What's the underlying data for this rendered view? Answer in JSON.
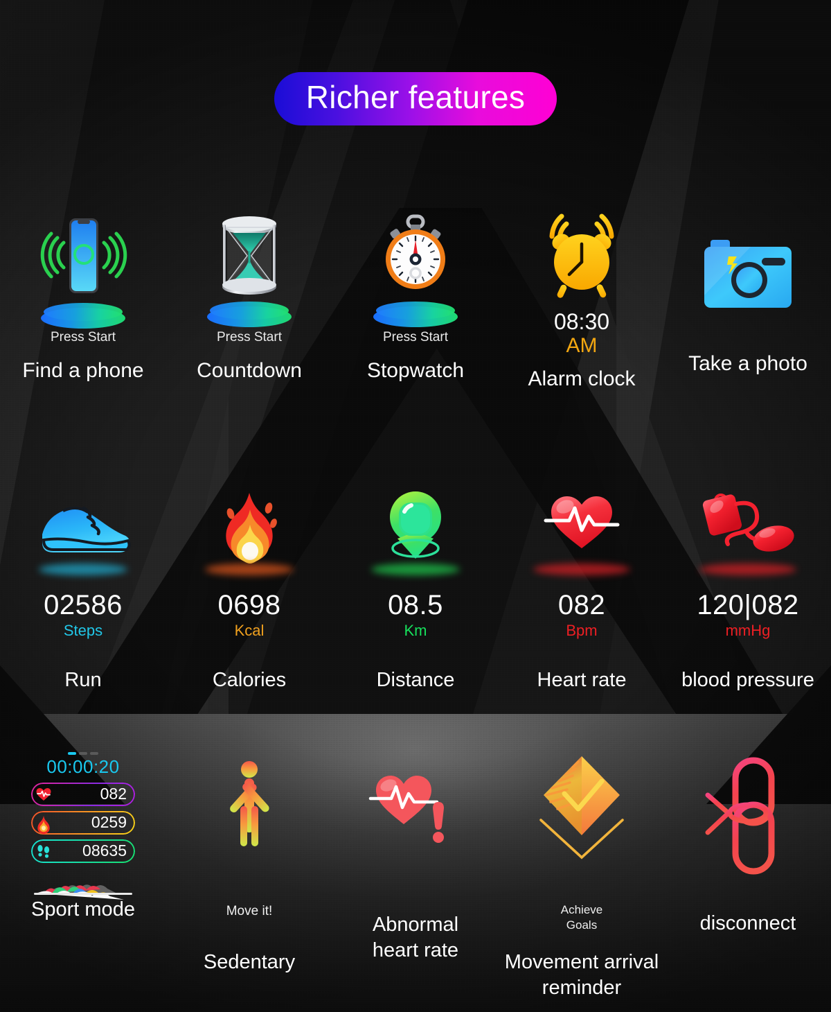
{
  "header": {
    "title": "Richer features",
    "gradient_from": "#1a0dd6",
    "gradient_to": "#ff00d4"
  },
  "row1": {
    "items": [
      {
        "label": "Find a phone",
        "status": "Press Start",
        "icon": "phone-ringing-icon",
        "has_pedestal": true
      },
      {
        "label": "Countdown",
        "status": "Press Start",
        "icon": "hourglass-icon",
        "has_pedestal": true
      },
      {
        "label": "Stopwatch",
        "status": "Press Start",
        "icon": "stopwatch-icon",
        "has_pedestal": true
      },
      {
        "label": "Alarm clock",
        "time": "08:30",
        "ampm": "AM",
        "icon": "alarm-clock-icon",
        "has_pedestal": false
      },
      {
        "label": "Take a photo",
        "icon": "camera-icon",
        "has_pedestal": false
      }
    ]
  },
  "row2": {
    "items": [
      {
        "label": "Run",
        "value": "02586",
        "unit": "Steps",
        "unit_color": "#21c7e8",
        "icon": "running-shoe-icon",
        "glow_color": "#1fa6c8"
      },
      {
        "label": "Calories",
        "value": "0698",
        "unit": "Kcal",
        "unit_color": "#f0a01e",
        "icon": "flame-icon",
        "glow_color": "#d8541c"
      },
      {
        "label": "Distance",
        "value": "08.5",
        "unit": "Km",
        "unit_color": "#17e05c",
        "icon": "location-pin-icon",
        "glow_color": "#1ec24a"
      },
      {
        "label": "Heart rate",
        "value": "082",
        "unit": "Bpm",
        "unit_color": "#ee1f24",
        "icon": "heart-pulse-icon",
        "glow_color": "#cf1f24"
      },
      {
        "label": "blood pressure",
        "value": "120|082",
        "unit": "mmHg",
        "unit_color": "#ee1f24",
        "icon": "bp-cuff-icon",
        "glow_color": "#cf1f24"
      }
    ]
  },
  "row3": {
    "items": [
      {
        "label": "Sport mode",
        "icon": "sport-mode-widget"
      },
      {
        "label": "Sedentary",
        "caption": "Move it!",
        "icon": "stick-figure-icon"
      },
      {
        "label": "Abnormal\nheart rate",
        "icon": "abnormal-heart-icon"
      },
      {
        "label": "Movement arrival\nreminder",
        "caption": "Achieve\nGoals",
        "icon": "achievement-badge-icon"
      },
      {
        "label": "disconnect",
        "icon": "broken-link-icon"
      }
    ]
  },
  "sport_mode": {
    "timer": "00:00:20",
    "metrics": [
      {
        "icon": "heart-pulse-icon",
        "value": "082",
        "from": "#e0249a",
        "to": "#8a2be2"
      },
      {
        "icon": "flame-icon",
        "value": "0259",
        "from": "#f2522a",
        "to": "#f7d417"
      },
      {
        "icon": "footsteps-icon",
        "value": "08635",
        "from": "#17e0d0",
        "to": "#17e070"
      }
    ]
  },
  "labels": {
    "row3_line_split": "\n"
  }
}
